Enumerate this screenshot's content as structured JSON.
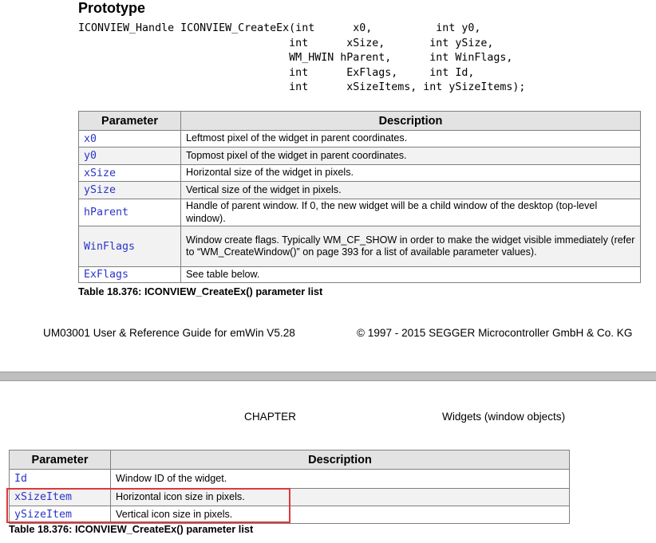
{
  "page1": {
    "heading": "Prototype",
    "prototype_lines": [
      "ICONVIEW_Handle ICONVIEW_CreateEx(int      x0,          int y0,",
      "                                 int      xSize,       int ySize,",
      "                                 WM_HWIN hParent,      int WinFlags,",
      "                                 int      ExFlags,     int Id,",
      "                                 int      xSizeItems, int ySizeItems);"
    ],
    "table": {
      "headers": [
        "Parameter",
        "Description"
      ],
      "rows": [
        {
          "param": "x0",
          "desc": "Leftmost pixel of the widget in parent coordinates."
        },
        {
          "param": "y0",
          "desc": "Topmost pixel of the widget in parent coordinates."
        },
        {
          "param": "xSize",
          "desc": "Horizontal size of the widget in pixels."
        },
        {
          "param": "ySize",
          "desc": "Vertical size of the widget in pixels."
        },
        {
          "param": "hParent",
          "desc": "Handle of parent window. If 0, the new widget will be a child window of the desktop (top-level window)."
        },
        {
          "param": "WinFlags",
          "desc": "Window create flags. Typically WM_CF_SHOW in order to make the widget visible immediately (refer to “WM_CreateWindow()” on page 393 for a list of available parameter values)."
        },
        {
          "param": "ExFlags",
          "desc": "See table below."
        }
      ]
    },
    "caption": "Table 18.376: ICONVIEW_CreateEx() parameter list",
    "footer_left": "UM03001 User & Reference Guide for emWin V5.28",
    "footer_right": "© 1997 - 2015 SEGGER Microcontroller GmbH & Co. KG"
  },
  "page2": {
    "header_left": "CHAPTER",
    "header_right": "Widgets (window objects)",
    "table": {
      "headers": [
        "Parameter",
        "Description"
      ],
      "rows": [
        {
          "param": "Id",
          "desc": "Window ID of the widget."
        },
        {
          "param": "xSizeItem",
          "desc": "Horizontal icon size in pixels."
        },
        {
          "param": "ySizeItem",
          "desc": "Vertical icon size in pixels."
        }
      ]
    },
    "caption": "Table 18.376: ICONVIEW_CreateEx() parameter list"
  },
  "colors": {
    "param_text": "#2a35c8",
    "highlight_border": "#e0383a",
    "header_bg": "#e3e3e3",
    "alt_row_bg": "#f2f2f2"
  }
}
